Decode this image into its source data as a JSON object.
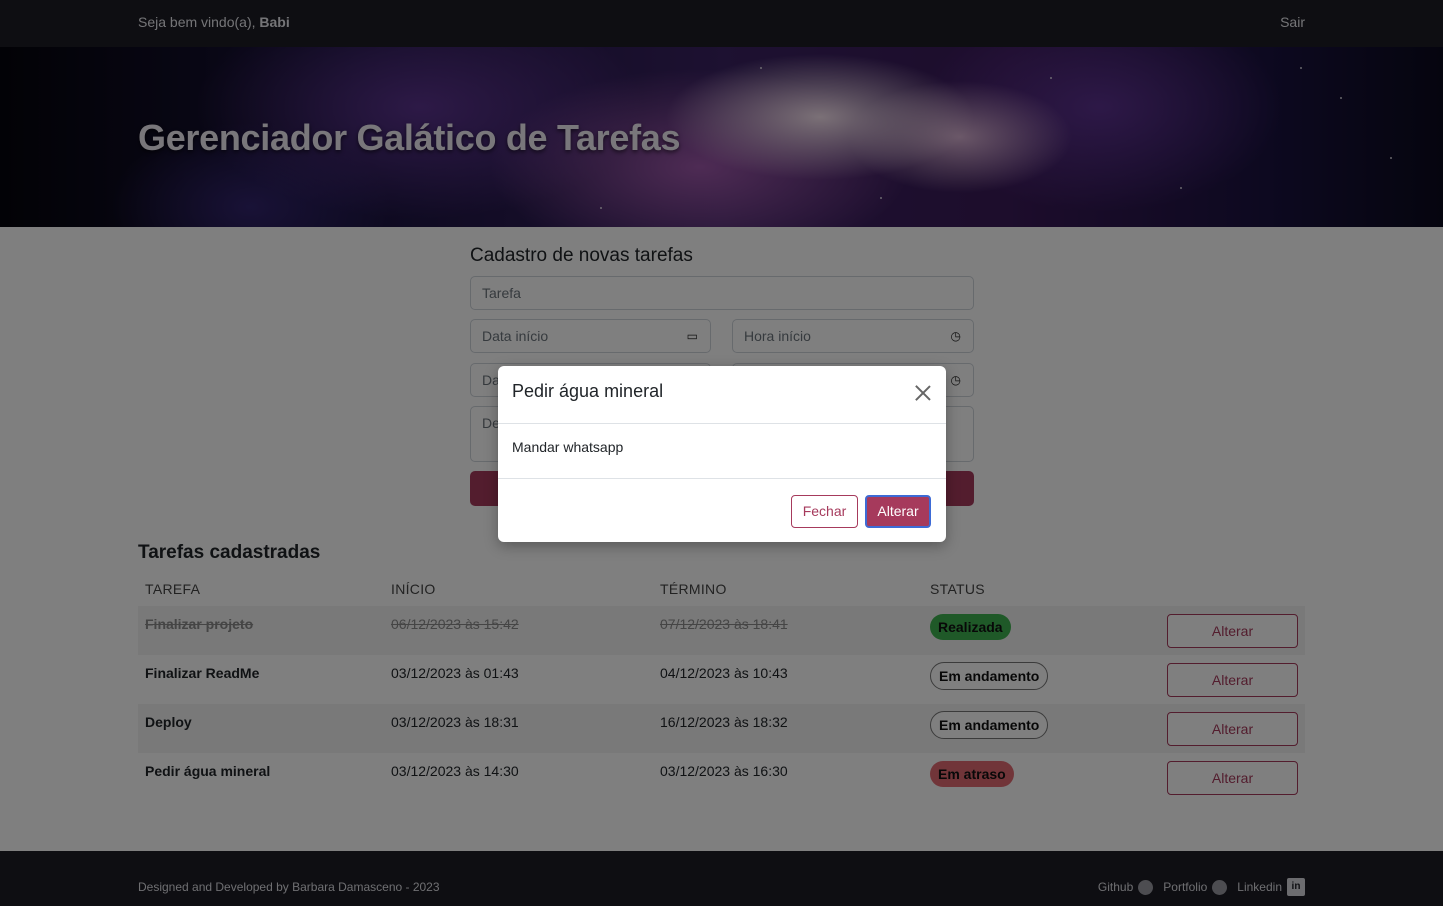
{
  "navbar": {
    "welcome_prefix": "Seja bem vindo(a), ",
    "username": "Babi",
    "logout_label": "Sair"
  },
  "hero": {
    "title": "Gerenciador Galático de Tarefas"
  },
  "form": {
    "title": "Cadastro de novas tarefas",
    "task_placeholder": "Tarefa",
    "start_date_placeholder": "Data início",
    "start_time_placeholder": "Hora início",
    "end_date_placeholder_partial": "Da",
    "description_placeholder_partial": "De"
  },
  "tasks": {
    "title": "Tarefas cadastradas",
    "columns": [
      "TAREFA",
      "INÍCIO",
      "TÉRMINO",
      "STATUS"
    ],
    "rows": [
      {
        "name": "Finalizar projeto",
        "start": "06/12/2023 às 15:42",
        "end": "07/12/2023 às 18:41",
        "status": "Realizada",
        "action": "Alterar"
      },
      {
        "name": "Finalizar ReadMe",
        "start": "03/12/2023 às 01:43",
        "end": "04/12/2023 às 10:43",
        "status": "Em andamento",
        "action": "Alterar"
      },
      {
        "name": "Deploy",
        "start": "03/12/2023 às 18:31",
        "end": "16/12/2023 às 18:32",
        "status": "Em andamento",
        "action": "Alterar"
      },
      {
        "name": "Pedir água mineral",
        "start": "03/12/2023 às 14:30",
        "end": "03/12/2023 às 16:30",
        "status": "Em atraso",
        "action": "Alterar"
      }
    ]
  },
  "modal": {
    "title": "Pedir água mineral",
    "body": "Mandar whatsapp",
    "close_label": "Fechar",
    "confirm_label": "Alterar"
  },
  "footer": {
    "copyright": "Designed and Developed by Barbara Damasceno - 2023",
    "links": [
      {
        "label": "Github",
        "icon": "github-icon"
      },
      {
        "label": "Portfolio",
        "icon": "globe-icon"
      },
      {
        "label": "Linkedin",
        "icon": "linkedin-icon"
      }
    ]
  },
  "colors": {
    "accent": "#a63a5c",
    "navbar_bg": "#1c1d24",
    "status_done": "#3fb350",
    "status_late": "#e36a73"
  }
}
